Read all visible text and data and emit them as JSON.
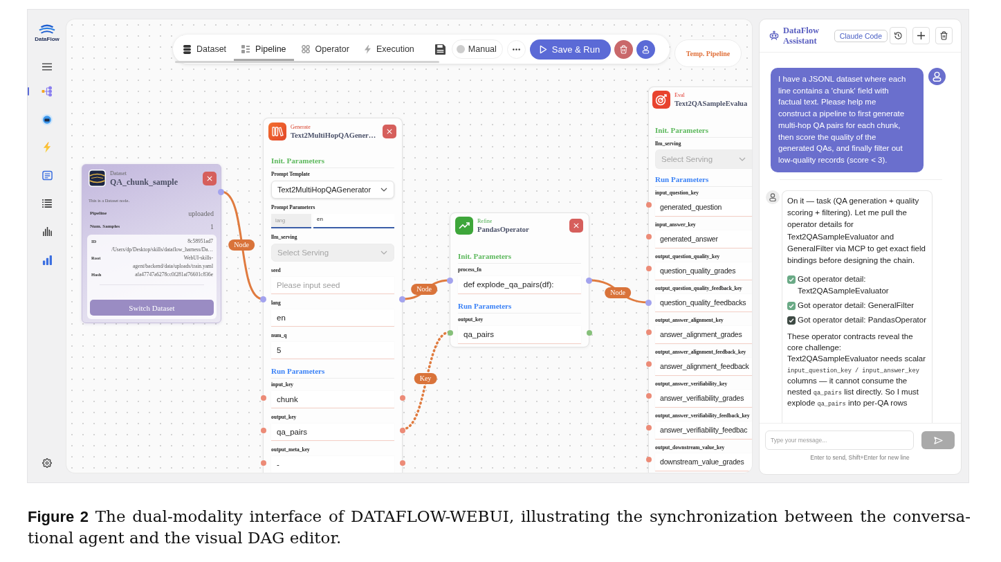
{
  "sidebar": {
    "logo_text": "DataFlow",
    "nav": [
      {
        "selected": true
      },
      {
        "selected": false
      },
      {
        "selected": false
      },
      {
        "selected": false
      },
      {
        "selected": false
      },
      {
        "selected": false
      },
      {
        "selected": false
      }
    ]
  },
  "toolbar": {
    "tabs": [
      {
        "label": "Dataset",
        "selected": false
      },
      {
        "label": "Pipeline",
        "selected": true
      },
      {
        "label": "Operator",
        "selected": false
      },
      {
        "label": "Execution",
        "selected": false
      }
    ],
    "mode": {
      "label": "Manual",
      "on": false
    },
    "run_button": "Save & Run"
  },
  "pipeline_badge": "Temp. Pipeline",
  "dataset_node": {
    "category": "Dataset",
    "title": "QA_chunk_sample",
    "description": "This is a Dataset node.",
    "stats": [
      {
        "label": "Pipeline",
        "value": "uploaded"
      },
      {
        "label": "Num. Samples",
        "value": "1"
      }
    ],
    "details": [
      {
        "label": "ID",
        "value": "8c58951ad7"
      },
      {
        "value": "/Users/dp/Desktop/skills/dataflow_harness/Da…"
      },
      {
        "label": "Root",
        "value": "WebUI-skills-agent/backend/data/uploads/train.yaml"
      },
      {
        "label": "Hash",
        "value": "afa47747a6278cc0f281af76601c836e"
      }
    ],
    "button": "Switch Dataset",
    "port": {
      "color": "#a3a3ee"
    }
  },
  "operator_nodes": [
    {
      "kind": "generate",
      "category": "Generate",
      "title": "Text2MultiHopQAGener…",
      "node_port": {
        "color": "#a3a3ee"
      },
      "sections": [
        {
          "kind": "init",
          "heading": "Init. Parameters",
          "fields": [
            {
              "label": "Prompt Template",
              "kind": "select",
              "value": "Text2MultiHopQAGenerator",
              "disabled": false
            },
            {
              "label": "Prompt Parameters",
              "kind": "pair",
              "key": "lang",
              "value": "en"
            },
            {
              "label": "llm_serving",
              "kind": "select",
              "placeholder": "Select Serving",
              "disabled": true
            },
            {
              "label": "seed",
              "kind": "input",
              "placeholder": "Please input seed"
            },
            {
              "label": "lang",
              "kind": "input",
              "value": "en"
            },
            {
              "label": "num_q",
              "kind": "input",
              "value": "5"
            }
          ]
        },
        {
          "kind": "run",
          "heading": "Run Parameters",
          "fields": [
            {
              "label": "input_key",
              "kind": "input",
              "value": "chunk",
              "port": {
                "color": "#ec8b77"
              }
            },
            {
              "label": "output_key",
              "kind": "input",
              "value": "qa_pairs",
              "port": {
                "color": "#ec8b77"
              }
            },
            {
              "label": "output_meta_key",
              "kind": "input",
              "value": "-",
              "port": {
                "color": "#ec8b77"
              }
            }
          ]
        }
      ]
    },
    {
      "kind": "refine",
      "category": "Refine",
      "title": "PandasOperator",
      "node_port": {
        "color": "#a3a3ee"
      },
      "sections": [
        {
          "kind": "init",
          "heading": "Init. Parameters",
          "fields": [
            {
              "label": "process_fn",
              "kind": "input",
              "value": "def explode_qa_pairs(df):"
            }
          ]
        },
        {
          "kind": "run",
          "heading": "Run Parameters",
          "fields": [
            {
              "label": "output_key",
              "kind": "input",
              "value": "qa_pairs",
              "port": {
                "color": "#86c07a"
              }
            }
          ]
        }
      ]
    },
    {
      "kind": "eval",
      "category": "Eval",
      "title": "Text2QASampleEvalua",
      "node_port": {
        "color": "#a3a3ee"
      },
      "sections": [
        {
          "kind": "init",
          "heading": "Init. Parameters",
          "fields": [
            {
              "label": "llm_serving",
              "kind": "select",
              "placeholder": "Select Serving",
              "disabled": true
            }
          ]
        },
        {
          "kind": "run",
          "heading": "Run Parameters",
          "fields": [
            {
              "label": "input_question_key",
              "kind": "input",
              "value": "generated_question",
              "port": {
                "color": "#ec8b77"
              }
            },
            {
              "label": "input_answer_key",
              "kind": "input",
              "value": "generated_answer",
              "port": {
                "color": "#ec8b77"
              }
            },
            {
              "label": "output_question_quality_key",
              "kind": "input",
              "value": "question_quality_grades",
              "port": {
                "color": "#ec8b77"
              }
            },
            {
              "label": "output_question_quality_feedback_key",
              "kind": "input",
              "value": "question_quality_feedbacks"
            },
            {
              "label": "output_answer_alignment_key",
              "kind": "input",
              "value": "answer_alignment_grades",
              "port": {
                "color": "#ec8b77"
              }
            },
            {
              "label": "output_answer_alignment_feedback_key",
              "kind": "input",
              "value": "answer_alignment_feedback",
              "port": {
                "color": "#ec8b77"
              }
            },
            {
              "label": "output_answer_verifiability_key",
              "kind": "input",
              "value": "answer_verifiability_grades",
              "port": {
                "color": "#ec8b77"
              }
            },
            {
              "label": "output_answer_verifiability_feedback_key",
              "kind": "input",
              "value": "answer_verifiability_feedbac",
              "port": {
                "color": "#ec8b77"
              }
            },
            {
              "label": "output_downstream_value_key",
              "kind": "input",
              "value": "downstream_value_grades",
              "port": {
                "color": "#ec8b77"
              }
            }
          ]
        }
      ]
    }
  ],
  "edges": [
    {
      "kind": "node",
      "label": "Node"
    },
    {
      "kind": "node",
      "label": "Node"
    },
    {
      "kind": "node",
      "label": "Node"
    },
    {
      "kind": "key",
      "label": "Key"
    }
  ],
  "assistant": {
    "title": "DataFlow Assistant",
    "agent": "Claude Code",
    "messages": [
      {
        "kind": "user",
        "text": "I have a JSONL dataset where each line contains a 'chunk' field with factual text. Please help me construct a pipeline to first generate multi-hop QA pairs for each chunk, then score the quality of the generated QAs, and finally filter out low-quality records (score < 3)."
      },
      {
        "kind": "assistant",
        "text": "On it — task (QA generation + quality scoring + filtering). Let me pull the operator details for Text2QASampleEvaluator and GeneralFilter via MCP to get exact field bindings before designing the chain.",
        "steps": [
          {
            "text": "Got operator detail: Text2QASampleEvaluator",
            "checked": true,
            "color": "#6aaa86"
          },
          {
            "text": "Got operator detail: GeneralFilter",
            "checked": true,
            "color": "#6aaa86"
          },
          {
            "text": "Got operator detail: PandasOperator",
            "checked": true,
            "color": "#3e4a44"
          }
        ],
        "paragraph": [
          {
            "kind": "text",
            "text": "These operator contracts reveal the core challenge: Text2QASampleEvaluator needs scalar "
          },
          {
            "kind": "code",
            "text": "input_question_key / input_answer_key"
          },
          {
            "kind": "text",
            "text": " columns — it cannot consume the nested "
          },
          {
            "kind": "code",
            "text": "qa_pairs"
          },
          {
            "kind": "text",
            "text": " list directly. So I must explode "
          },
          {
            "kind": "code",
            "text": "qa_pairs"
          },
          {
            "kind": "text",
            "text": " into per-QA rows"
          }
        ]
      }
    ],
    "input": {
      "placeholder": "Type your message..."
    },
    "hint": "Enter to send, Shift+Enter for new line"
  },
  "caption": {
    "label": "Figure 2",
    "text": "The dual-modality interface of DATAFLOW-WEBUI, illustrating the synchronization between the conversa-tional agent and the visual DAG editor."
  }
}
